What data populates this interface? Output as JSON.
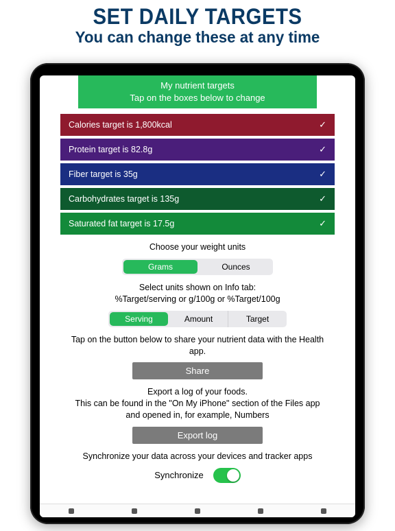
{
  "promo": {
    "title": "SET DAILY TARGETS",
    "subtitle": "You can change these at any time"
  },
  "header": {
    "line1": "My nutrient targets",
    "line2": "Tap on the boxes below to change"
  },
  "targets": [
    {
      "label": "Calories target is 1,800kcal",
      "color": "#8f1a2e"
    },
    {
      "label": "Protein target is 82.8g",
      "color": "#4a1e7a"
    },
    {
      "label": "Fiber target is 35g",
      "color": "#1a2e82"
    },
    {
      "label": "Carbohydrates target is 135g",
      "color": "#0e5a2e"
    },
    {
      "label": "Saturated fat target is 17.5g",
      "color": "#138a3a"
    }
  ],
  "weight_units": {
    "prompt": "Choose your weight units",
    "options": [
      "Grams",
      "Ounces"
    ],
    "selected": "Grams"
  },
  "info_units": {
    "prompt": "Select units shown on Info tab:\n%Target/serving or g/100g or %Target/100g",
    "options": [
      "Serving",
      "Amount",
      "Target"
    ],
    "selected": "Serving"
  },
  "share": {
    "prompt": "Tap on the button below to share your nutrient data with the Health app.",
    "button": "Share"
  },
  "export": {
    "prompt": "Export a log of your foods.\nThis can be found in the \"On My iPhone\" section of the Files app and opened in, for example, Numbers",
    "button": "Export log"
  },
  "sync": {
    "prompt": "Synchronize your data across your devices and tracker apps",
    "label": "Synchronize",
    "on": true
  }
}
